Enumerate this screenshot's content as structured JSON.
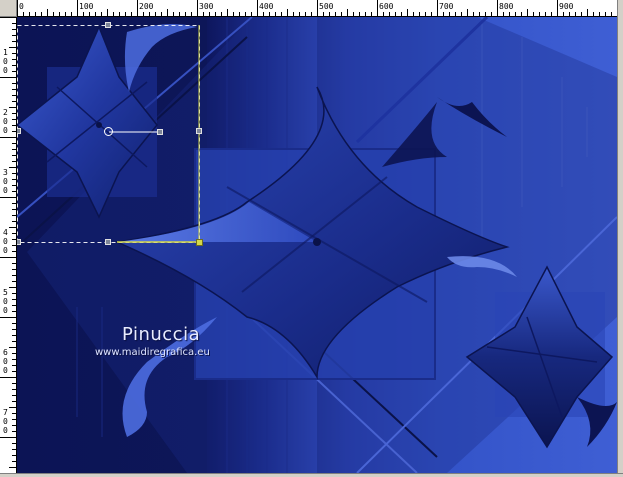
{
  "ruler": {
    "top_labels": [
      "0",
      "100",
      "200",
      "300",
      "400",
      "500",
      "600",
      "700",
      "800",
      "900"
    ],
    "left_labels": [
      "100",
      "200",
      "300",
      "400",
      "500",
      "600",
      "700"
    ]
  },
  "watermark": {
    "name": "Pinuccia",
    "url": "www.maidiregrafica.eu"
  },
  "colors": {
    "background_dark": "#0b1450",
    "background_mid": "#2b45b8",
    "background_light": "#3d5fd6",
    "handle": "#7d8598",
    "active_handle": "#d4d84a",
    "selection_line": "#ffffff"
  },
  "icons": {
    "rotation_handle": "circle-handle-icon",
    "resize_handle": "square-handle-icon"
  }
}
